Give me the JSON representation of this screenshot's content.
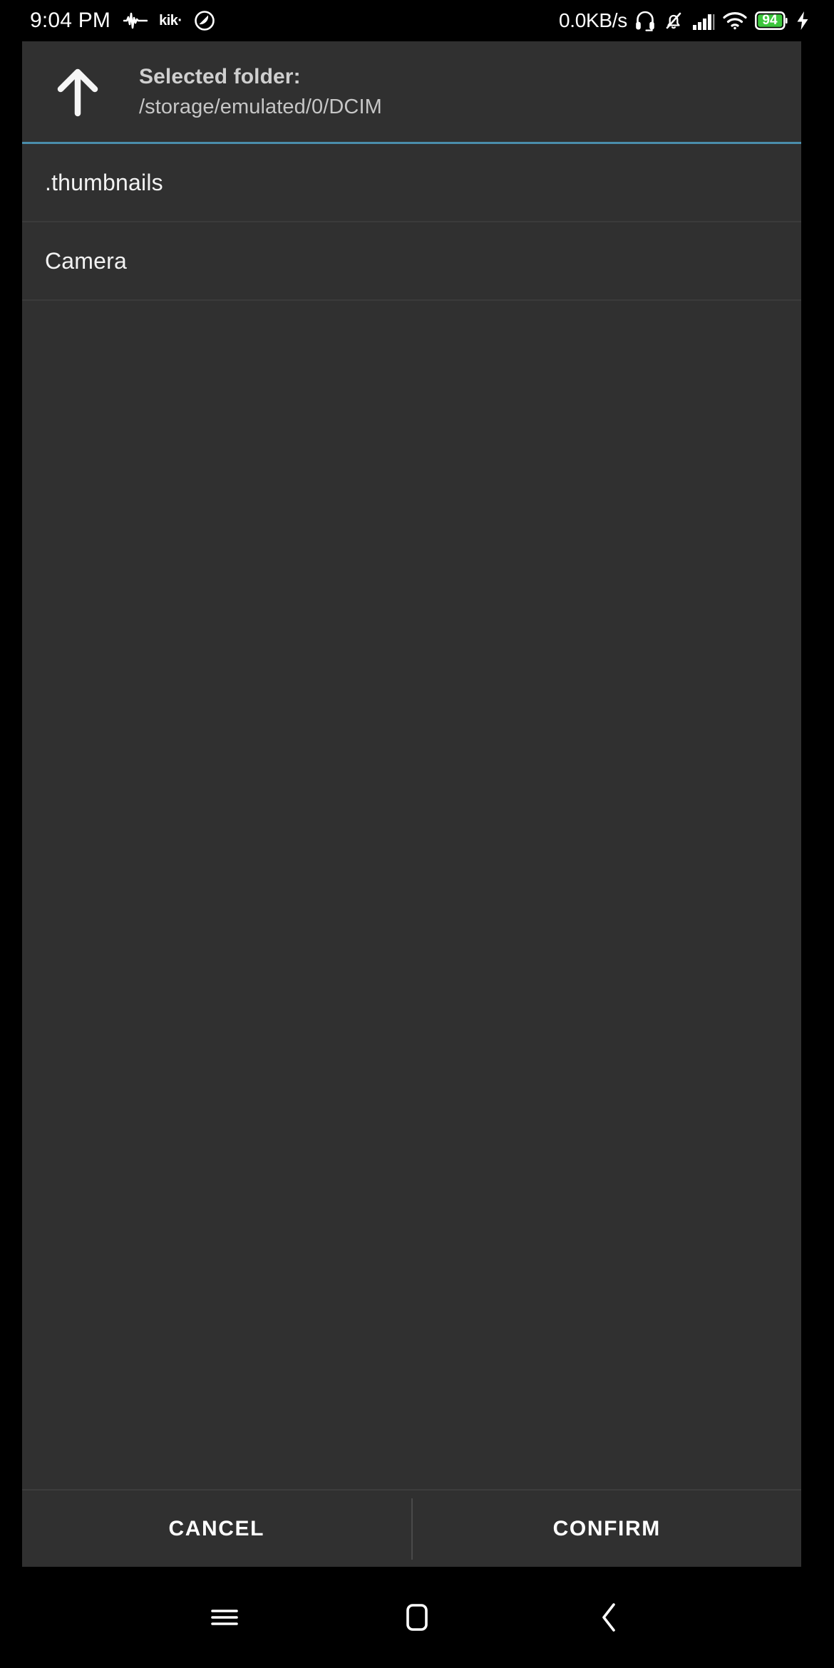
{
  "status_bar": {
    "time": "9:04 PM",
    "network_speed": "0.0KB/s",
    "battery_level": "94",
    "left_icons": [
      {
        "name": "audio-waveform-icon",
        "glyph": "waveform"
      },
      {
        "name": "kik-app-icon",
        "label": "kik·"
      },
      {
        "name": "do-not-disturb-icon",
        "glyph": "circle-slash"
      }
    ],
    "right_icons": [
      {
        "name": "headset-icon"
      },
      {
        "name": "notifications-muted-icon"
      },
      {
        "name": "cellular-signal-icon"
      },
      {
        "name": "wifi-icon"
      },
      {
        "name": "battery-icon"
      },
      {
        "name": "charging-bolt-icon"
      }
    ],
    "colors": {
      "battery_fill": "#3cc63c",
      "text": "#ffffff",
      "background": "#000000"
    }
  },
  "dialog": {
    "header": {
      "up_button_name": "navigate-up-button",
      "label": "Selected folder:",
      "path": "/storage/emulated/0/DCIM"
    },
    "accent_color": "#4a8dab",
    "items": [
      {
        "name": ".thumbnails"
      },
      {
        "name": "Camera"
      }
    ],
    "actions": {
      "cancel_label": "CANCEL",
      "confirm_label": "CONFIRM"
    },
    "colors": {
      "background": "#303030",
      "divider": "#3b3b3b",
      "text_primary": "#f2f2f2",
      "text_secondary": "#c6c6c6"
    }
  },
  "nav_bar": {
    "buttons": [
      {
        "name": "recents-button",
        "icon": "hamburger-icon"
      },
      {
        "name": "home-button",
        "icon": "square-icon"
      },
      {
        "name": "back-button",
        "icon": "chevron-left-icon"
      }
    ]
  }
}
